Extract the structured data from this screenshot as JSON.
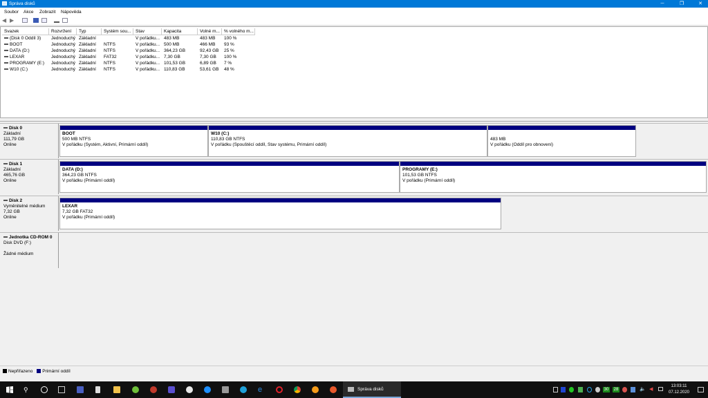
{
  "window": {
    "title": "Správa disků",
    "min": "─",
    "max": "❐",
    "close": "✕"
  },
  "menu": [
    "Soubor",
    "Akce",
    "Zobrazit",
    "Nápověda"
  ],
  "list": {
    "columns": [
      "Svazek",
      "Rozvržení",
      "Typ",
      "Systém sou...",
      "Stav",
      "Kapacita",
      "Volné m...",
      "% volného m..."
    ],
    "rows": [
      [
        "(Disk 0 Oddíl 3)",
        "Jednoduchý",
        "Základní",
        "",
        "V pořádku...",
        "483 MB",
        "483 MB",
        "100 %"
      ],
      [
        "BOOT",
        "Jednoduchý",
        "Základní",
        "NTFS",
        "V pořádku...",
        "500 MB",
        "466 MB",
        "93 %"
      ],
      [
        "DATA (D:)",
        "Jednoduchý",
        "Základní",
        "NTFS",
        "V pořádku...",
        "364,23 GB",
        "92,43 GB",
        "25 %"
      ],
      [
        "LEXAR",
        "Jednoduchý",
        "Základní",
        "FAT32",
        "V pořádku...",
        "7,30 GB",
        "7,30 GB",
        "100 %"
      ],
      [
        "PROGRAMY (E:)",
        "Jednoduchý",
        "Základní",
        "NTFS",
        "V pořádku...",
        "101,53 GB",
        "6,89 GB",
        "7 %"
      ],
      [
        "W10 (C:)",
        "Jednoduchý",
        "Základní",
        "NTFS",
        "V pořádku...",
        "110,83 GB",
        "53,61 GB",
        "48 %"
      ]
    ]
  },
  "disks": [
    {
      "name": "Disk 0",
      "type": "Základní",
      "size": "111,79 GB",
      "status": "Online",
      "parts": [
        {
          "name": "BOOT",
          "size": "500 MB NTFS",
          "status": "V pořádku (Systém, Aktivní, Primární oddíl)"
        },
        {
          "name": "W10  (C:)",
          "size": "110,83 GB NTFS",
          "status": "V pořádku (Spouštěcí oddíl, Stav systému, Primární oddíl)"
        },
        {
          "name": "",
          "size": "483 MB",
          "status": "V pořádku (Oddíl pro obnovení)"
        }
      ]
    },
    {
      "name": "Disk 1",
      "type": "Základní",
      "size": "465,76 GB",
      "status": "Online",
      "parts": [
        {
          "name": "DATA  (D:)",
          "size": "364,23 GB NTFS",
          "status": "V pořádku (Primární oddíl)"
        },
        {
          "name": "PROGRAMY  (E:)",
          "size": "101,53 GB NTFS",
          "status": "V pořádku (Primární oddíl)"
        }
      ]
    },
    {
      "name": "Disk 2",
      "type": "Vyměnitelné médium",
      "size": "7,32 GB",
      "status": "Online",
      "parts": [
        {
          "name": "LEXAR",
          "size": "7,32 GB FAT32",
          "status": "V pořádku (Primární oddíl)"
        }
      ]
    },
    {
      "name": "Jednotka CD-ROM 0",
      "type": "Disk DVD (F:)",
      "size": "",
      "status": "Žádné médium"
    }
  ],
  "legend": [
    {
      "label": "Nepřiřazeno",
      "color": "#000000"
    },
    {
      "label": "Primární oddíl",
      "color": "#000080"
    }
  ],
  "taskbar": {
    "active_app": "Správa disků",
    "time": "13:03:11",
    "date": "07.12.2020",
    "badge1": "30",
    "badge2": "28"
  }
}
